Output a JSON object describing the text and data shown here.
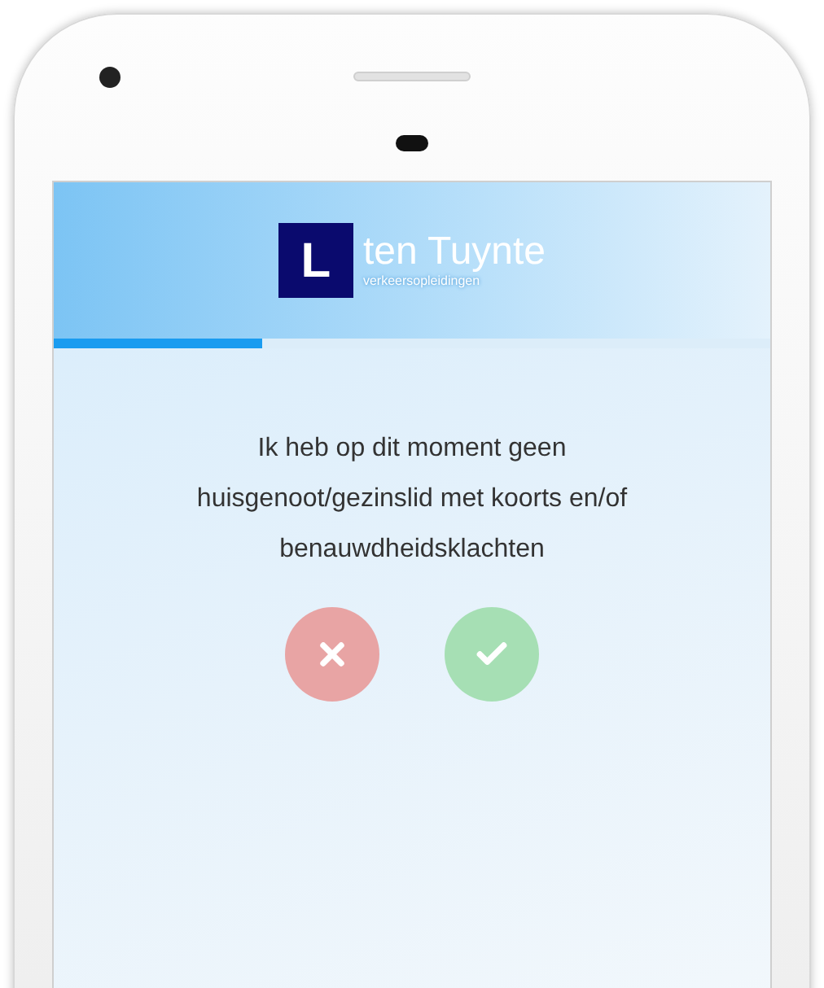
{
  "logo": {
    "letter": "L",
    "name": "ten Tuynte",
    "tagline": "verkeersopleidingen"
  },
  "progress": {
    "level": 0.29
  },
  "question": "Ik heb op dit moment geen huisgenoot/gezinslid met koorts en/of benauwdheidsklachten",
  "answers": [
    {
      "kind": "no"
    },
    {
      "kind": "yes"
    }
  ]
}
